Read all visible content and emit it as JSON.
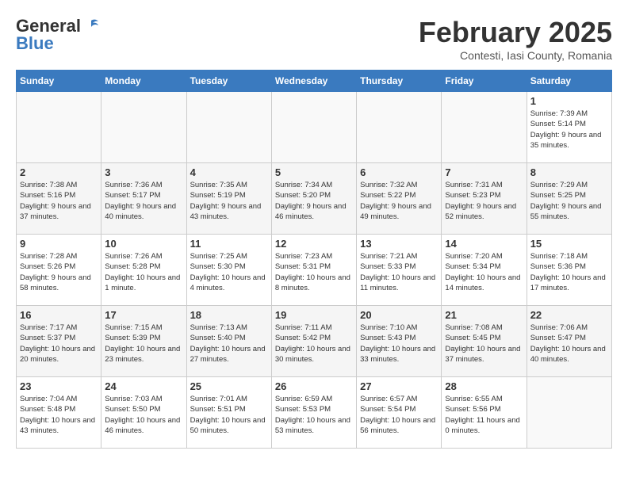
{
  "header": {
    "logo_line1": "General",
    "logo_line2": "Blue",
    "month": "February 2025",
    "location": "Contesti, Iasi County, Romania"
  },
  "days_of_week": [
    "Sunday",
    "Monday",
    "Tuesday",
    "Wednesday",
    "Thursday",
    "Friday",
    "Saturday"
  ],
  "weeks": [
    [
      {
        "day": "",
        "info": ""
      },
      {
        "day": "",
        "info": ""
      },
      {
        "day": "",
        "info": ""
      },
      {
        "day": "",
        "info": ""
      },
      {
        "day": "",
        "info": ""
      },
      {
        "day": "",
        "info": ""
      },
      {
        "day": "1",
        "info": "Sunrise: 7:39 AM\nSunset: 5:14 PM\nDaylight: 9 hours and 35 minutes."
      }
    ],
    [
      {
        "day": "2",
        "info": "Sunrise: 7:38 AM\nSunset: 5:16 PM\nDaylight: 9 hours and 37 minutes."
      },
      {
        "day": "3",
        "info": "Sunrise: 7:36 AM\nSunset: 5:17 PM\nDaylight: 9 hours and 40 minutes."
      },
      {
        "day": "4",
        "info": "Sunrise: 7:35 AM\nSunset: 5:19 PM\nDaylight: 9 hours and 43 minutes."
      },
      {
        "day": "5",
        "info": "Sunrise: 7:34 AM\nSunset: 5:20 PM\nDaylight: 9 hours and 46 minutes."
      },
      {
        "day": "6",
        "info": "Sunrise: 7:32 AM\nSunset: 5:22 PM\nDaylight: 9 hours and 49 minutes."
      },
      {
        "day": "7",
        "info": "Sunrise: 7:31 AM\nSunset: 5:23 PM\nDaylight: 9 hours and 52 minutes."
      },
      {
        "day": "8",
        "info": "Sunrise: 7:29 AM\nSunset: 5:25 PM\nDaylight: 9 hours and 55 minutes."
      }
    ],
    [
      {
        "day": "9",
        "info": "Sunrise: 7:28 AM\nSunset: 5:26 PM\nDaylight: 9 hours and 58 minutes."
      },
      {
        "day": "10",
        "info": "Sunrise: 7:26 AM\nSunset: 5:28 PM\nDaylight: 10 hours and 1 minute."
      },
      {
        "day": "11",
        "info": "Sunrise: 7:25 AM\nSunset: 5:30 PM\nDaylight: 10 hours and 4 minutes."
      },
      {
        "day": "12",
        "info": "Sunrise: 7:23 AM\nSunset: 5:31 PM\nDaylight: 10 hours and 8 minutes."
      },
      {
        "day": "13",
        "info": "Sunrise: 7:21 AM\nSunset: 5:33 PM\nDaylight: 10 hours and 11 minutes."
      },
      {
        "day": "14",
        "info": "Sunrise: 7:20 AM\nSunset: 5:34 PM\nDaylight: 10 hours and 14 minutes."
      },
      {
        "day": "15",
        "info": "Sunrise: 7:18 AM\nSunset: 5:36 PM\nDaylight: 10 hours and 17 minutes."
      }
    ],
    [
      {
        "day": "16",
        "info": "Sunrise: 7:17 AM\nSunset: 5:37 PM\nDaylight: 10 hours and 20 minutes."
      },
      {
        "day": "17",
        "info": "Sunrise: 7:15 AM\nSunset: 5:39 PM\nDaylight: 10 hours and 23 minutes."
      },
      {
        "day": "18",
        "info": "Sunrise: 7:13 AM\nSunset: 5:40 PM\nDaylight: 10 hours and 27 minutes."
      },
      {
        "day": "19",
        "info": "Sunrise: 7:11 AM\nSunset: 5:42 PM\nDaylight: 10 hours and 30 minutes."
      },
      {
        "day": "20",
        "info": "Sunrise: 7:10 AM\nSunset: 5:43 PM\nDaylight: 10 hours and 33 minutes."
      },
      {
        "day": "21",
        "info": "Sunrise: 7:08 AM\nSunset: 5:45 PM\nDaylight: 10 hours and 37 minutes."
      },
      {
        "day": "22",
        "info": "Sunrise: 7:06 AM\nSunset: 5:47 PM\nDaylight: 10 hours and 40 minutes."
      }
    ],
    [
      {
        "day": "23",
        "info": "Sunrise: 7:04 AM\nSunset: 5:48 PM\nDaylight: 10 hours and 43 minutes."
      },
      {
        "day": "24",
        "info": "Sunrise: 7:03 AM\nSunset: 5:50 PM\nDaylight: 10 hours and 46 minutes."
      },
      {
        "day": "25",
        "info": "Sunrise: 7:01 AM\nSunset: 5:51 PM\nDaylight: 10 hours and 50 minutes."
      },
      {
        "day": "26",
        "info": "Sunrise: 6:59 AM\nSunset: 5:53 PM\nDaylight: 10 hours and 53 minutes."
      },
      {
        "day": "27",
        "info": "Sunrise: 6:57 AM\nSunset: 5:54 PM\nDaylight: 10 hours and 56 minutes."
      },
      {
        "day": "28",
        "info": "Sunrise: 6:55 AM\nSunset: 5:56 PM\nDaylight: 11 hours and 0 minutes."
      },
      {
        "day": "",
        "info": ""
      }
    ]
  ]
}
